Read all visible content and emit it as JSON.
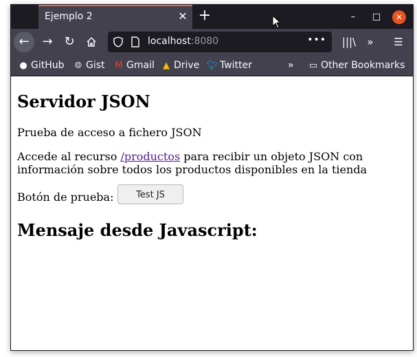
{
  "browser": {
    "tab_title": "Ejemplo 2",
    "tab_close": "✕",
    "new_tab": "+",
    "window_controls": {
      "minimize": "–",
      "maximize": "□",
      "close": "✕"
    },
    "url_host": "localhost",
    "url_port": ":8080",
    "url_more": "•••",
    "bookmarks": [
      {
        "label": "GitHub",
        "icon": "github-icon"
      },
      {
        "label": "Gist",
        "icon": "globe-icon"
      },
      {
        "label": "Gmail",
        "icon": "gmail-icon"
      },
      {
        "label": "Drive",
        "icon": "drive-icon"
      },
      {
        "label": "Twitter",
        "icon": "twitter-icon"
      }
    ],
    "other_bookmarks": "Other Bookmarks"
  },
  "page": {
    "title": "Servidor JSON",
    "intro": "Prueba de acceso a fichero JSON",
    "access_before": "Accede al recurso ",
    "access_link": "/productos",
    "access_after": " para recibir un objeto JSON con información sobre todos los productos disponibles en la tienda",
    "test_label": "Botón de prueba: ",
    "test_button": "Test JS",
    "message_heading": "Mensaje desde Javascript:"
  },
  "colors": {
    "tab_accent": "#e66b3a",
    "chrome_dark": "#1c1b22",
    "chrome_mid": "#42414d",
    "link": "#551a8b",
    "close_button": "#e95420"
  }
}
